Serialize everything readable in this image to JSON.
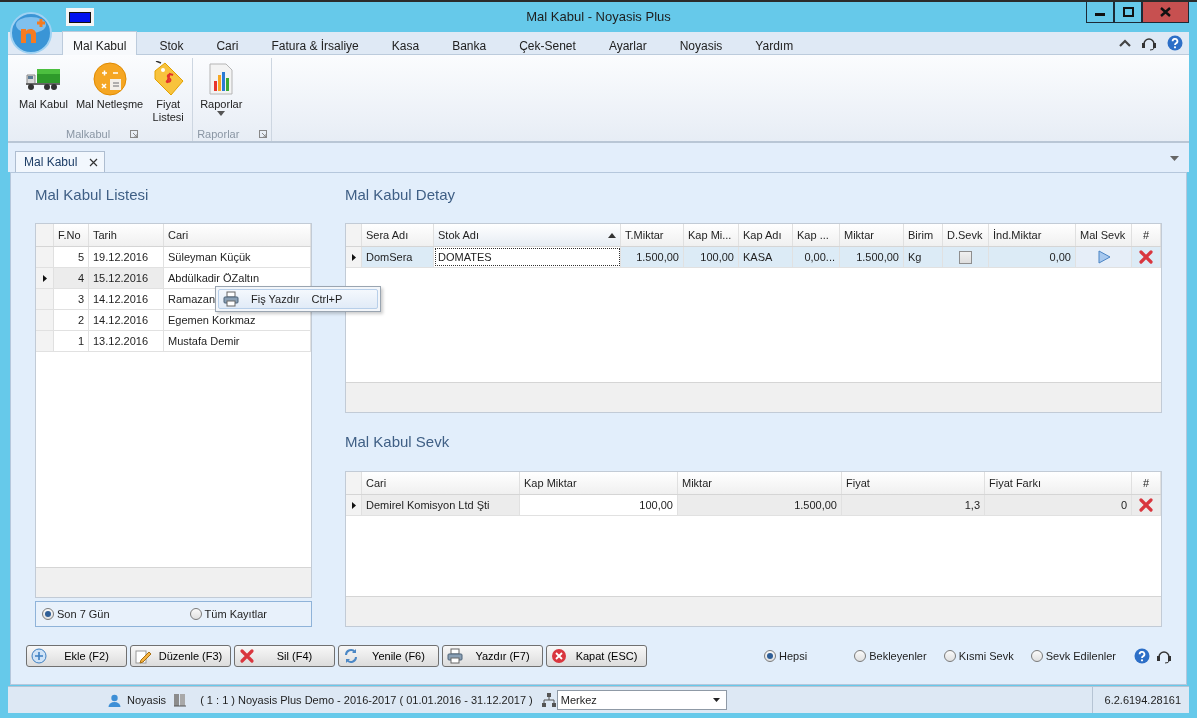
{
  "window": {
    "title": "Mal Kabul - Noyasis Plus"
  },
  "ribbon": {
    "tabs": [
      {
        "label": "Mal Kabul",
        "selected": true
      },
      {
        "label": "Stok",
        "selected": false
      },
      {
        "label": "Cari",
        "selected": false
      },
      {
        "label": "Fatura & İrsaliye",
        "selected": false
      },
      {
        "label": "Kasa",
        "selected": false
      },
      {
        "label": "Banka",
        "selected": false
      },
      {
        "label": "Çek-Senet",
        "selected": false
      },
      {
        "label": "Ayarlar",
        "selected": false
      },
      {
        "label": "Noyasis",
        "selected": false
      },
      {
        "label": "Yardım",
        "selected": false
      }
    ],
    "groups": [
      {
        "label": "Malkabul",
        "buttons": [
          {
            "label": "Mal Kabul",
            "dropdown": false
          },
          {
            "label": "Mal Netleşme",
            "dropdown": false
          },
          {
            "label": "Fiyat\nListesi",
            "dropdown": false
          }
        ]
      },
      {
        "label": "Raporlar",
        "buttons": [
          {
            "label": "Raporlar",
            "dropdown": true
          }
        ]
      }
    ]
  },
  "document_tabs": [
    {
      "label": "Mal Kabul",
      "selected": true
    }
  ],
  "list_panel": {
    "title": "Mal Kabul Listesi",
    "columns": [
      "F.No",
      "Tarih",
      "Cari"
    ],
    "rows": [
      {
        "cells": [
          "5",
          "19.12.2016",
          "Süleyman Küçük"
        ],
        "selected": false
      },
      {
        "cells": [
          "4",
          "15.12.2016",
          "Abdülkadir ÖZaltın"
        ],
        "selected": true
      },
      {
        "cells": [
          "3",
          "14.12.2016",
          "Ramazan"
        ],
        "selected": false
      },
      {
        "cells": [
          "2",
          "14.12.2016",
          "Egemen Korkmaz"
        ],
        "selected": false
      },
      {
        "cells": [
          "1",
          "13.12.2016",
          "Mustafa Demir"
        ],
        "selected": false
      }
    ],
    "filters": [
      {
        "label": "Son 7 Gün",
        "selected": true
      },
      {
        "label": "Tüm Kayıtlar",
        "selected": false
      }
    ]
  },
  "context_menu": {
    "items": [
      {
        "label": "Fiş Yazdır",
        "shortcut": "Ctrl+P"
      }
    ]
  },
  "detail": {
    "title": "Mal Kabul Detay",
    "columns": [
      {
        "label": "Sera Adı",
        "sorted": false
      },
      {
        "label": "Stok Adı",
        "sorted": true
      },
      {
        "label": "T.Miktar",
        "sorted": false
      },
      {
        "label": "Kap Mi...",
        "sorted": false
      },
      {
        "label": "Kap Adı",
        "sorted": false
      },
      {
        "label": "Kap ...",
        "sorted": false
      },
      {
        "label": "Miktar",
        "sorted": false
      },
      {
        "label": "Birim",
        "sorted": false
      },
      {
        "label": "D.Sevk",
        "sorted": false
      },
      {
        "label": "İnd.Miktar",
        "sorted": false
      },
      {
        "label": "Mal Sevk",
        "sorted": false
      },
      {
        "label": "#",
        "sorted": false
      }
    ],
    "rows": [
      {
        "selected": true,
        "cells": [
          {
            "kind": "text",
            "value": "DomSera"
          },
          {
            "kind": "edit",
            "value": "DOMATES"
          },
          {
            "kind": "number",
            "value": "1.500,00"
          },
          {
            "kind": "number",
            "value": "100,00"
          },
          {
            "kind": "text",
            "value": "KASA"
          },
          {
            "kind": "number",
            "value": "0,00..."
          },
          {
            "kind": "number",
            "value": "1.500,00"
          },
          {
            "kind": "text",
            "value": "Kg"
          },
          {
            "kind": "check",
            "checked": false
          },
          {
            "kind": "number",
            "value": "0,00"
          },
          {
            "kind": "action"
          },
          {
            "kind": "delete"
          }
        ]
      }
    ]
  },
  "sevk": {
    "title": "Mal Kabul Sevk",
    "columns": [
      {
        "label": "Cari",
        "sorted": false
      },
      {
        "label": "Kap Miktar",
        "sorted": false
      },
      {
        "label": "Miktar",
        "sorted": false
      },
      {
        "label": "Fiyat",
        "sorted": false
      },
      {
        "label": "Fiyat Farkı",
        "sorted": false
      },
      {
        "label": "#",
        "sorted": false
      }
    ],
    "rows": [
      {
        "selected": true,
        "cells": [
          {
            "kind": "text",
            "value": "Demirel Komisyon Ltd Şti"
          },
          {
            "kind": "edit-number",
            "value": "100,00"
          },
          {
            "kind": "number",
            "value": "1.500,00"
          },
          {
            "kind": "number",
            "value": "1,3"
          },
          {
            "kind": "number",
            "value": "0"
          },
          {
            "kind": "delete"
          }
        ]
      }
    ]
  },
  "actions": [
    {
      "label": "Ekle (F2)"
    },
    {
      "label": "Düzenle (F3)"
    },
    {
      "label": "Sil (F4)"
    },
    {
      "label": "Yenile (F6)"
    },
    {
      "label": "Yazdır (F7)"
    },
    {
      "label": "Kapat (ESC)"
    }
  ],
  "sevk_filters": [
    {
      "label": "Hepsi",
      "selected": true
    },
    {
      "label": "Bekleyenler",
      "selected": false
    },
    {
      "label": "Kısmi Sevk",
      "selected": false
    },
    {
      "label": "Sevk Edilenler",
      "selected": false
    }
  ],
  "status_bar": {
    "user": "Noyasis",
    "company": "( 1 : 1 )  Noyasis Plus Demo - 2016-2017  ( 01.01.2016 - 31.12.2017 )",
    "branch": "Merkez",
    "version": "6.2.6194.28161"
  }
}
